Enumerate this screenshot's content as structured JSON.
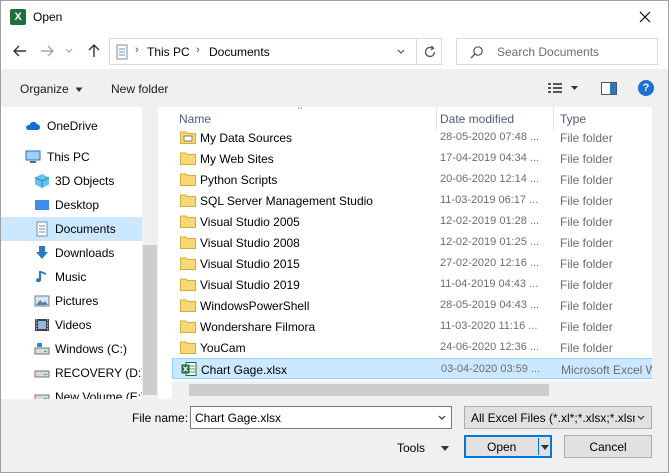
{
  "window": {
    "title": "Open",
    "app_icon": "excel-icon",
    "app_icon_letter": "X",
    "close_icon": "close-icon"
  },
  "nav": {
    "back_icon": "arrow-left-icon",
    "forward_icon": "arrow-right-icon",
    "recent_icon": "chevron-down-icon",
    "up_icon": "arrow-up-icon"
  },
  "address": {
    "breadcrumbs": [
      "This PC",
      "Documents"
    ],
    "refresh_icon": "refresh-icon"
  },
  "search": {
    "placeholder": "Search Documents"
  },
  "toolbar": {
    "organize_label": "Organize",
    "new_folder_label": "New folder",
    "view_icon": "view-details-icon",
    "preview_icon": "preview-pane-icon",
    "help_icon": "help-icon",
    "help_glyph": "?"
  },
  "sidebar": {
    "items": [
      {
        "label": "OneDrive",
        "icon": "cloud-icon"
      },
      {
        "label": "This PC",
        "icon": "computer-icon"
      },
      {
        "label": "3D Objects",
        "icon": "cube-icon"
      },
      {
        "label": "Desktop",
        "icon": "desktop-icon"
      },
      {
        "label": "Documents",
        "icon": "document-icon"
      },
      {
        "label": "Downloads",
        "icon": "download-icon"
      },
      {
        "label": "Music",
        "icon": "music-icon"
      },
      {
        "label": "Pictures",
        "icon": "picture-icon"
      },
      {
        "label": "Videos",
        "icon": "video-icon"
      },
      {
        "label": "Windows (C:)",
        "icon": "drive-icon"
      },
      {
        "label": "RECOVERY (D:)",
        "icon": "drive-icon"
      },
      {
        "label": "New Volume (E:)",
        "icon": "drive-icon"
      }
    ],
    "selected_index": 4
  },
  "filelist": {
    "columns": {
      "name": "Name",
      "date": "Date modified",
      "type": "Type"
    },
    "rows": [
      {
        "name": "My Data Sources",
        "date": "28-05-2020 07:48 ...",
        "type": "File folder",
        "icon": "folder-data-icon"
      },
      {
        "name": "My Web Sites",
        "date": "17-04-2019 04:34 ...",
        "type": "File folder",
        "icon": "folder-icon"
      },
      {
        "name": "Python Scripts",
        "date": "20-06-2020 12:14 ...",
        "type": "File folder",
        "icon": "folder-icon"
      },
      {
        "name": "SQL Server Management Studio",
        "date": "11-03-2019 06:17 ...",
        "type": "File folder",
        "icon": "folder-icon"
      },
      {
        "name": "Visual Studio 2005",
        "date": "12-02-2019 01:28 ...",
        "type": "File folder",
        "icon": "folder-icon"
      },
      {
        "name": "Visual Studio 2008",
        "date": "12-02-2019 01:25 ...",
        "type": "File folder",
        "icon": "folder-icon"
      },
      {
        "name": "Visual Studio 2015",
        "date": "27-02-2020 12:16 ...",
        "type": "File folder",
        "icon": "folder-icon"
      },
      {
        "name": "Visual Studio 2019",
        "date": "11-04-2019 04:43 ...",
        "type": "File folder",
        "icon": "folder-icon"
      },
      {
        "name": "WindowsPowerShell",
        "date": "28-05-2019 04:43 ...",
        "type": "File folder",
        "icon": "folder-icon"
      },
      {
        "name": "Wondershare Filmora",
        "date": "11-03-2020 11:16 ...",
        "type": "File folder",
        "icon": "folder-icon"
      },
      {
        "name": "YouCam",
        "date": "24-06-2020 12:36 ...",
        "type": "File folder",
        "icon": "folder-icon"
      },
      {
        "name": "Chart Gage.xlsx",
        "date": "03-04-2020 03:59 ...",
        "type": "Microsoft Excel W",
        "icon": "excel-file-icon"
      }
    ],
    "selected_index": 11
  },
  "bottom": {
    "file_name_label": "File name:",
    "file_name_value": "Chart Gage.xlsx",
    "filter_value": "All Excel Files (*.xl*;*.xlsx;*.xlsm",
    "tools_label": "Tools",
    "open_label": "Open",
    "cancel_label": "Cancel"
  },
  "colors": {
    "selection": "#cce8ff",
    "accent": "#0078d7",
    "folder": "#f8d775",
    "excel": "#1d6f42"
  }
}
